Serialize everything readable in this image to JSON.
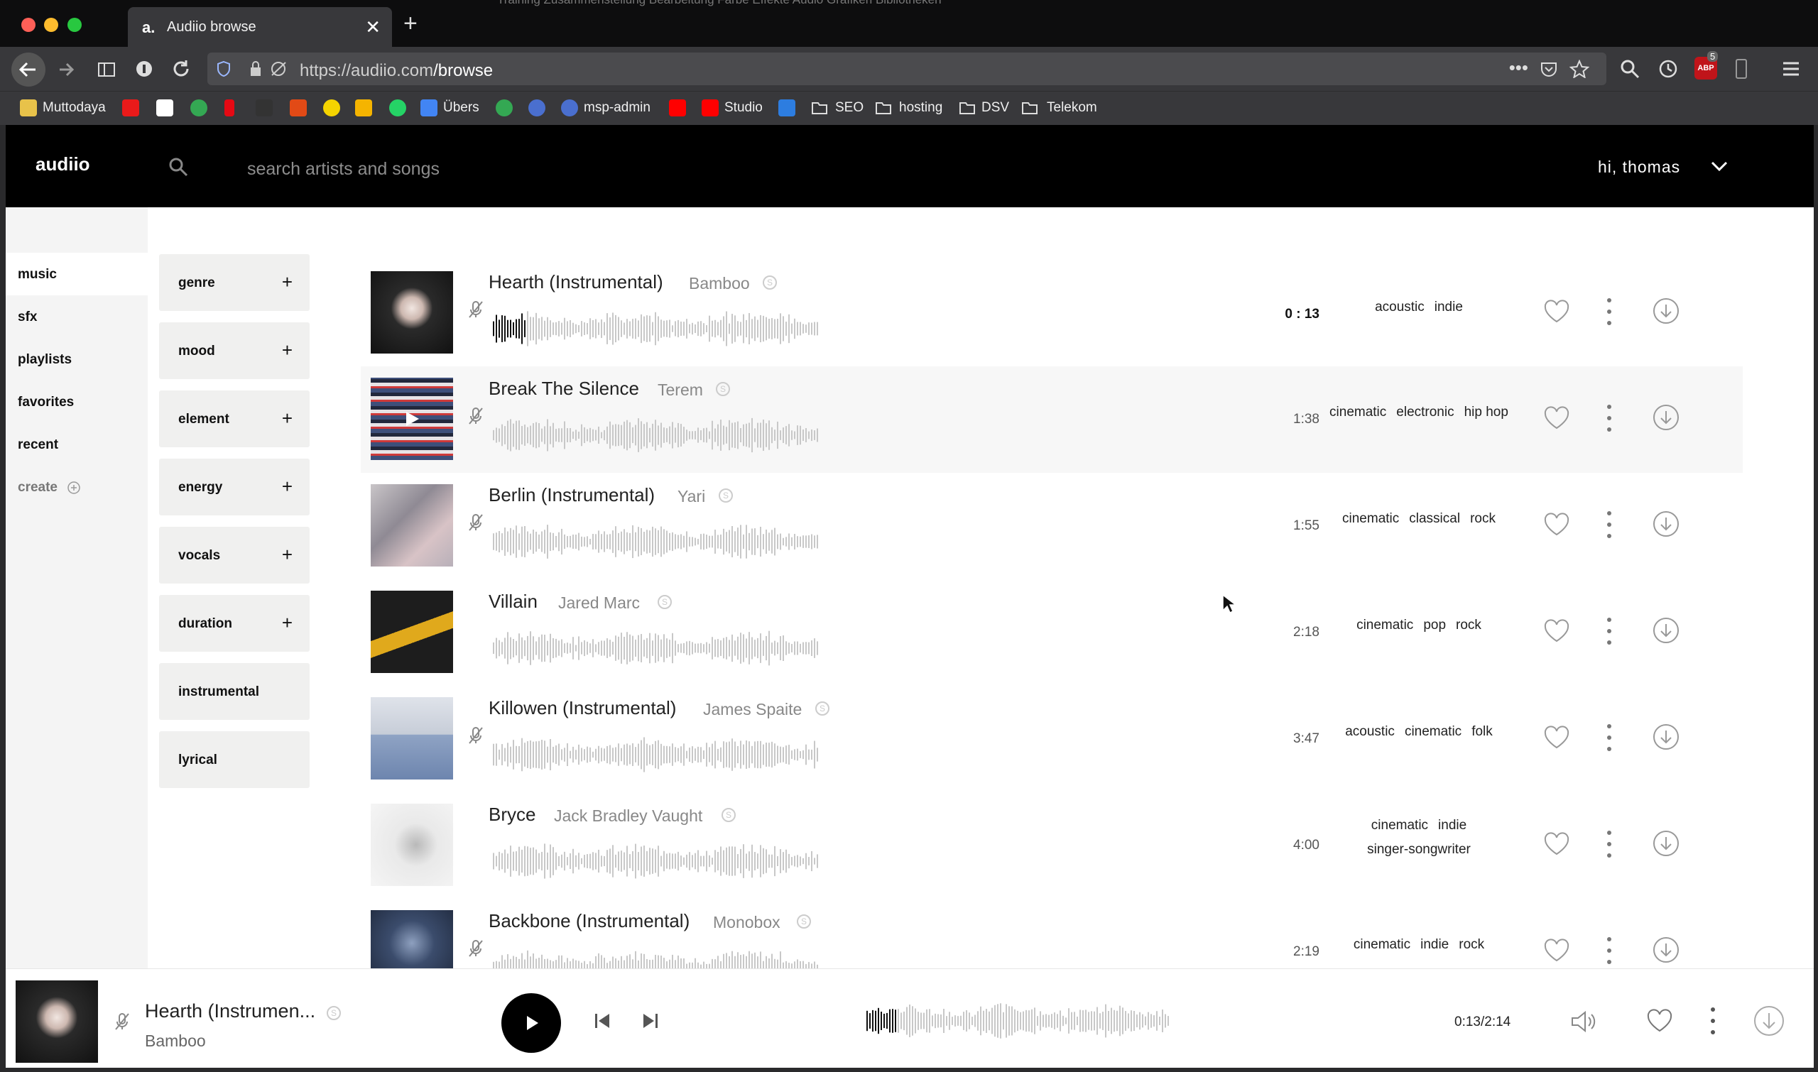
{
  "browser": {
    "tab_title": "Audiio browse",
    "url_host": "https://audiio.com",
    "url_path": "/browse",
    "ghost_tabs": "Training    Zusammenstellung    Bearbeitung    Farbe    Effekte    Audio    Grafiken    Bibliotheken",
    "extension_badge": "5",
    "bookmarks": [
      "Muttodaya",
      "Übers",
      "msp-admin",
      "Studio",
      "SEO",
      "hosting",
      "DSV",
      "Telekom"
    ]
  },
  "app": {
    "logo": "audiio",
    "search_placeholder": "search artists and songs",
    "user_greeting": "hi, thomas"
  },
  "sidebar": {
    "items": [
      {
        "label": "music",
        "active": true
      },
      {
        "label": "sfx"
      },
      {
        "label": "playlists"
      },
      {
        "label": "favorites"
      },
      {
        "label": "recent"
      },
      {
        "label": "create"
      }
    ]
  },
  "filters": [
    {
      "label": "genre",
      "expandable": true
    },
    {
      "label": "mood",
      "expandable": true
    },
    {
      "label": "element",
      "expandable": true
    },
    {
      "label": "energy",
      "expandable": true
    },
    {
      "label": "vocals",
      "expandable": true
    },
    {
      "label": "duration",
      "expandable": true
    },
    {
      "label": "instrumental",
      "expandable": false
    },
    {
      "label": "lyrical",
      "expandable": false
    }
  ],
  "badge_letter": "S",
  "tracks": [
    {
      "title": "Hearth (Instrumental)",
      "artist": "Bamboo",
      "duration": "0 : 13",
      "tags": [
        "acoustic",
        "indie"
      ],
      "playing": true,
      "instrumental": true,
      "progress": 0.1
    },
    {
      "title": "Break The Silence",
      "artist": "Terem",
      "duration": "1:38",
      "tags": [
        "cinematic",
        "electronic",
        "hip hop"
      ],
      "hover": true,
      "instrumental": true
    },
    {
      "title": "Berlin (Instrumental)",
      "artist": "Yari",
      "duration": "1:55",
      "tags": [
        "cinematic",
        "classical",
        "rock"
      ],
      "instrumental": true
    },
    {
      "title": "Villain",
      "artist": "Jared Marc",
      "duration": "2:18",
      "tags": [
        "cinematic",
        "pop",
        "rock"
      ],
      "instrumental": false
    },
    {
      "title": "Killowen (Instrumental)",
      "artist": "James Spaite",
      "duration": "3:47",
      "tags": [
        "acoustic",
        "cinematic",
        "folk"
      ],
      "instrumental": true
    },
    {
      "title": "Bryce",
      "artist": "Jack Bradley Vaught",
      "duration": "4:00",
      "tags": [
        "cinematic",
        "indie",
        "singer-songwriter"
      ],
      "instrumental": false
    },
    {
      "title": "Backbone (Instrumental)",
      "artist": "Monobox",
      "duration": "2:19",
      "tags": [
        "cinematic",
        "indie",
        "rock"
      ],
      "instrumental": true
    }
  ],
  "player": {
    "title": "Hearth (Instrumen...",
    "artist": "Bamboo",
    "time": "0:13/2:14",
    "progress": 0.1
  },
  "colors": {
    "accent": "#000000",
    "hover_row": "#f7f7f7",
    "filter_bg": "#f0f0ef",
    "waveform": "#c8c8c8",
    "waveform_played": "#111111"
  }
}
